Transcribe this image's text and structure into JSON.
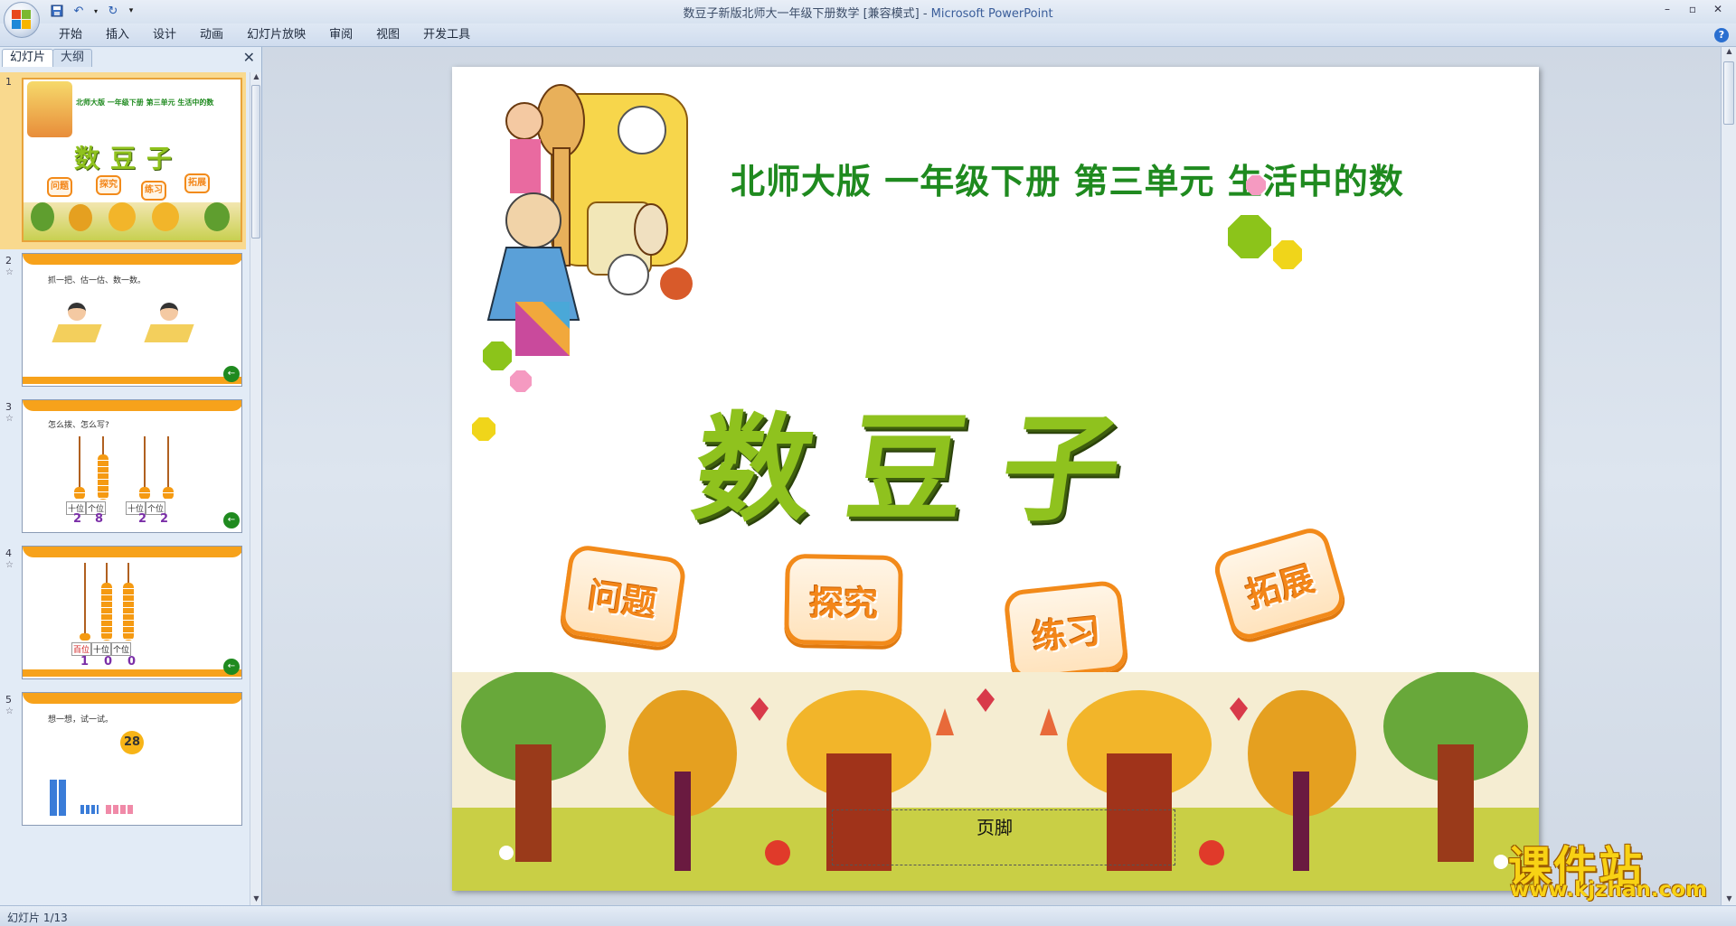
{
  "window": {
    "title_doc": "数豆子新版北师大一年级下册数学 [兼容模式] - ",
    "title_app": "Microsoft PowerPoint"
  },
  "ribbon": {
    "tabs": [
      "开始",
      "插入",
      "设计",
      "动画",
      "幻灯片放映",
      "审阅",
      "视图",
      "开发工具"
    ]
  },
  "panel": {
    "tab_slides": "幻灯片",
    "tab_outline": "大纲"
  },
  "thumbnails": [
    {
      "num": "1",
      "caption": "北师大版  一年级下册  第三单元  生活中的数",
      "title": "数豆子",
      "badges": [
        "问题",
        "探究",
        "练习",
        "拓展"
      ]
    },
    {
      "num": "2",
      "caption": "抓一把、估一估、数一数。"
    },
    {
      "num": "3",
      "caption": "怎么拨、怎么写?",
      "labels": [
        "十位",
        "个位",
        "十位",
        "个位"
      ],
      "digits": [
        "2",
        "8",
        "2",
        "2"
      ]
    },
    {
      "num": "4",
      "labels": [
        "百位",
        "十位",
        "个位"
      ],
      "digits": [
        "1",
        "0",
        "0"
      ]
    },
    {
      "num": "5",
      "caption": "想一想，试一试。",
      "circle_number": "28"
    }
  ],
  "slide": {
    "subtitle": "北师大版  一年级下册  第三单元  生活中的数",
    "title": "数豆子",
    "badges": [
      "问题",
      "探究",
      "练习",
      "拓展"
    ],
    "footer_placeholder": "页脚"
  },
  "status": {
    "slide_counter": "幻灯片 1/13"
  },
  "watermark": {
    "text": "课件站",
    "url": "www.kjzhan.com"
  },
  "colors": {
    "title_green": "#1f8a1f",
    "big_title": "#8fc21e",
    "badge_orange": "#f28a1a",
    "selected_thumb": "#f9d98e"
  }
}
